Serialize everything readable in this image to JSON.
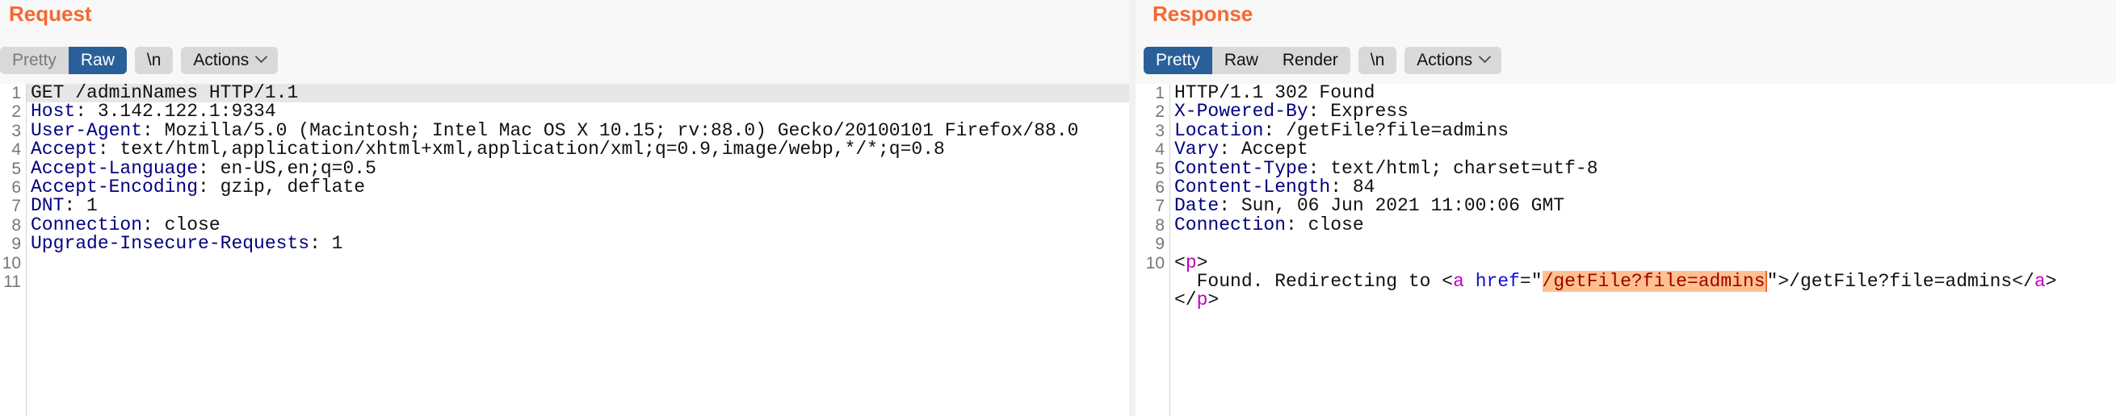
{
  "request": {
    "title": "Request",
    "tabs": [
      {
        "label": "Pretty",
        "active": false
      },
      {
        "label": "Raw",
        "active": true
      }
    ],
    "newline_label": "\\n",
    "actions_label": "Actions",
    "lines": [
      {
        "n": "1",
        "segs": [
          {
            "t": "GET /adminNames HTTP/1.1"
          }
        ]
      },
      {
        "n": "2",
        "segs": [
          {
            "t": "Host",
            "c": "k"
          },
          {
            "t": ": 3.142.122.1:9334"
          }
        ]
      },
      {
        "n": "3",
        "segs": [
          {
            "t": "User-Agent",
            "c": "k"
          },
          {
            "t": ": Mozilla/5.0 (Macintosh; Intel Mac OS X 10.15; rv:88.0) Gecko/20100101 Firefox/88.0"
          }
        ]
      },
      {
        "n": "4",
        "segs": [
          {
            "t": "Accept",
            "c": "k"
          },
          {
            "t": ": text/html,application/xhtml+xml,application/xml;q=0.9,image/webp,*/*;q=0.8"
          }
        ]
      },
      {
        "n": "5",
        "segs": [
          {
            "t": "Accept-Language",
            "c": "k"
          },
          {
            "t": ": en-US,en;q=0.5"
          }
        ]
      },
      {
        "n": "6",
        "segs": [
          {
            "t": "Accept-Encoding",
            "c": "k"
          },
          {
            "t": ": gzip, deflate"
          }
        ]
      },
      {
        "n": "7",
        "segs": [
          {
            "t": "DNT",
            "c": "k"
          },
          {
            "t": ": 1"
          }
        ]
      },
      {
        "n": "8",
        "segs": [
          {
            "t": "Connection",
            "c": "k"
          },
          {
            "t": ": close"
          }
        ]
      },
      {
        "n": "9",
        "segs": [
          {
            "t": "Upgrade-Insecure-Requests",
            "c": "k"
          },
          {
            "t": ": 1"
          }
        ]
      },
      {
        "n": "10",
        "segs": []
      },
      {
        "n": "11",
        "segs": []
      }
    ]
  },
  "response": {
    "title": "Response",
    "tabs": [
      {
        "label": "Pretty",
        "active": true
      },
      {
        "label": "Raw",
        "active": false
      },
      {
        "label": "Render",
        "active": false
      }
    ],
    "newline_label": "\\n",
    "actions_label": "Actions",
    "lines": [
      {
        "n": "1",
        "segs": [
          {
            "t": "HTTP/1.1 302 Found"
          }
        ]
      },
      {
        "n": "2",
        "segs": [
          {
            "t": "X-Powered-By",
            "c": "k"
          },
          {
            "t": ": Express"
          }
        ]
      },
      {
        "n": "3",
        "segs": [
          {
            "t": "Location",
            "c": "k"
          },
          {
            "t": ": /getFile?file=admins"
          }
        ]
      },
      {
        "n": "4",
        "segs": [
          {
            "t": "Vary",
            "c": "k"
          },
          {
            "t": ": Accept"
          }
        ]
      },
      {
        "n": "5",
        "segs": [
          {
            "t": "Content-Type",
            "c": "k"
          },
          {
            "t": ": text/html; charset=utf-8"
          }
        ]
      },
      {
        "n": "6",
        "segs": [
          {
            "t": "Content-Length",
            "c": "k"
          },
          {
            "t": ": 84"
          }
        ]
      },
      {
        "n": "7",
        "segs": [
          {
            "t": "Date",
            "c": "k"
          },
          {
            "t": ": Sun, 06 Jun 2021 11:00:06 GMT"
          }
        ]
      },
      {
        "n": "8",
        "segs": [
          {
            "t": "Connection",
            "c": "k"
          },
          {
            "t": ": close"
          }
        ]
      },
      {
        "n": "9",
        "segs": []
      },
      {
        "n": "10",
        "segs": [
          {
            "t": "<"
          },
          {
            "t": "p",
            "c": "tag"
          },
          {
            "t": ">"
          }
        ]
      },
      {
        "n": "",
        "segs": [
          {
            "t": "  Found. Redirecting to <"
          },
          {
            "t": "a",
            "c": "tag"
          },
          {
            "t": " "
          },
          {
            "t": "href",
            "c": "attr"
          },
          {
            "t": "=\""
          },
          {
            "t": "/getFile?file=admins",
            "c": "val hl caret"
          },
          {
            "t": "\">/getFile?file=admins</"
          },
          {
            "t": "a",
            "c": "tag"
          },
          {
            "t": ">"
          }
        ]
      },
      {
        "n": "",
        "segs": [
          {
            "t": "</"
          },
          {
            "t": "p",
            "c": "tag"
          },
          {
            "t": ">"
          }
        ]
      }
    ]
  },
  "colors": {
    "accent": "#f5682f",
    "active_tab": "#2a6099",
    "header_name": "#000080",
    "tag": "#c000c0",
    "attr": "#1010d0",
    "value": "#a00000",
    "selection": "#ffc090"
  }
}
